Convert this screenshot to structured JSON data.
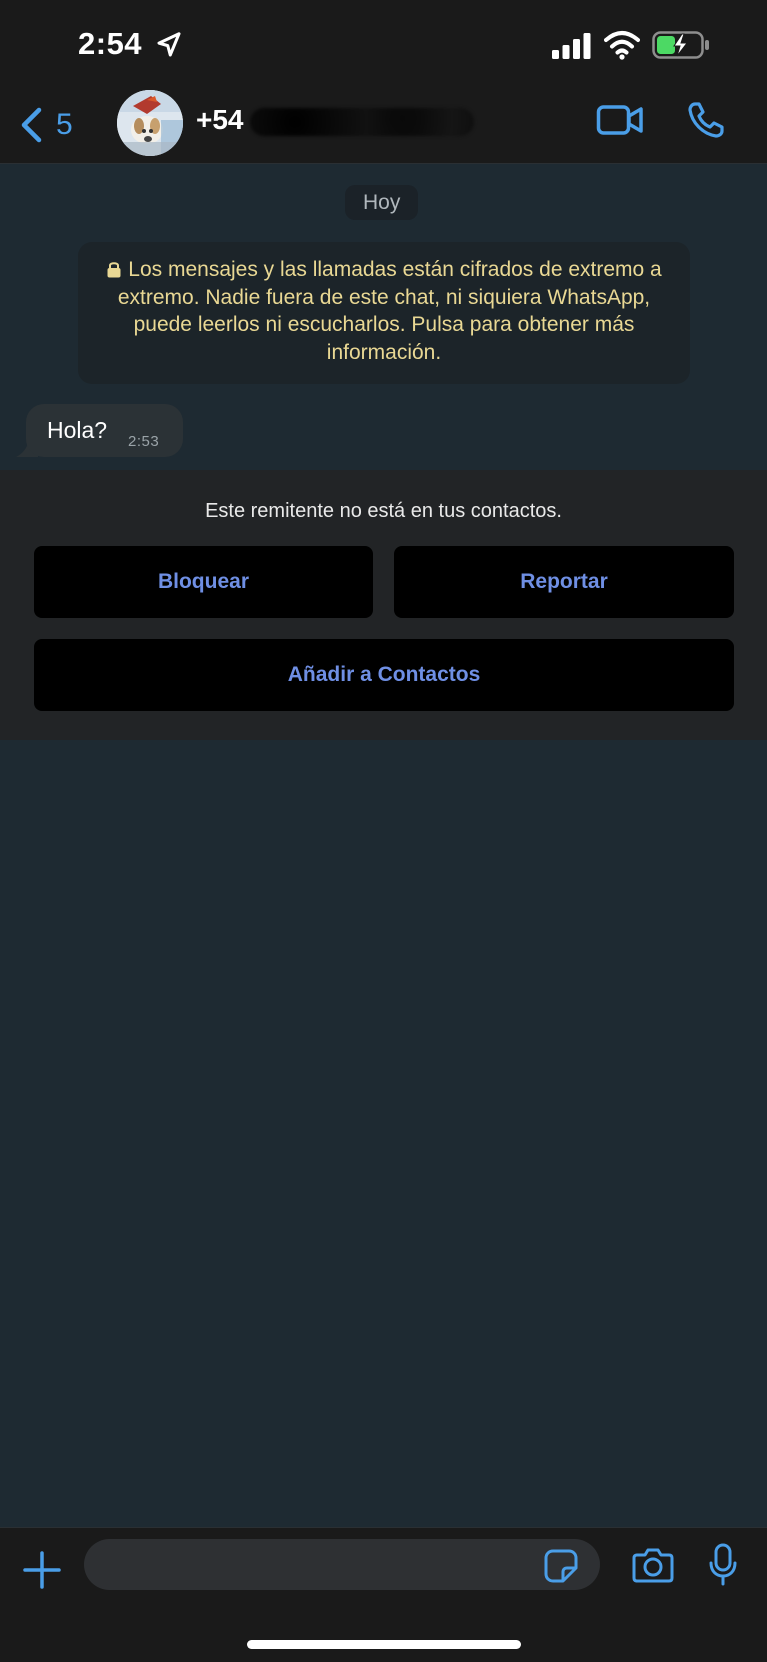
{
  "status_bar": {
    "time": "2:54",
    "icons": [
      "location-arrow-icon",
      "signal-icon",
      "wifi-icon",
      "battery-charging-icon"
    ]
  },
  "header": {
    "back_count": "5",
    "contact_name": "+54",
    "icons": [
      "chevron-left-icon",
      "video-call-icon",
      "phone-icon"
    ]
  },
  "chat": {
    "date_label": "Hoy",
    "encryption_notice": "Los mensajes y las llamadas están cifrados de extremo a extremo. Nadie fuera de este chat, ni siquiera WhatsApp, puede leerlos ni escucharlos. Pulsa para obtener más información.",
    "messages": [
      {
        "text": "Hola?",
        "time": "2:53",
        "direction": "incoming"
      }
    ]
  },
  "unknown_sender": {
    "notice": "Este remitente no está en tus contactos.",
    "block_label": "Bloquear",
    "report_label": "Reportar",
    "add_contact_label": "Añadir a Contactos"
  },
  "input_bar": {
    "placeholder": "",
    "icons": [
      "plus-icon",
      "sticker-icon",
      "camera-icon",
      "microphone-icon"
    ]
  },
  "colors": {
    "accent": "#4a9ee8",
    "action_text": "#6f8fe4",
    "chat_bg": "#1e2a32",
    "bar_bg": "#1a1a1a",
    "notice_text": "#e9d894",
    "battery_green": "#4cd964"
  }
}
